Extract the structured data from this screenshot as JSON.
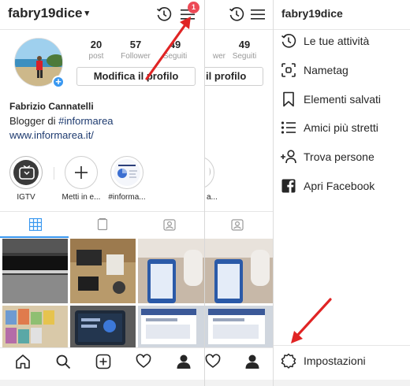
{
  "profile": {
    "username": "fabry19dice",
    "notification_count": "1",
    "stats": [
      {
        "value": "20",
        "label": "post"
      },
      {
        "value": "57",
        "label": "Follower"
      },
      {
        "value": "49",
        "label": "Seguiti"
      }
    ],
    "edit_button_label": "Modifica il profilo",
    "full_name": "Fabrizio Cannatelli",
    "bio_prefix": "Blogger di ",
    "bio_tag": "#informarea",
    "website": "www.informarea.it/",
    "highlights": [
      {
        "label": "IGTV"
      },
      {
        "label": "Metti in e..."
      },
      {
        "label": "#informa..."
      }
    ]
  },
  "pane2": {
    "stats": [
      {
        "value": "49",
        "label": "wer"
      },
      {
        "value": "49",
        "label": "Seguiti"
      }
    ],
    "edit_button_fragment": "il profilo",
    "highlight_fragment": "a..."
  },
  "menu": {
    "username": "fabry19dice",
    "items": [
      {
        "label": "Le tue attività",
        "icon": "activity-history-icon"
      },
      {
        "label": "Nametag",
        "icon": "nametag-icon"
      },
      {
        "label": "Elementi salvati",
        "icon": "bookmark-icon"
      },
      {
        "label": "Amici più stretti",
        "icon": "close-friends-list-icon"
      },
      {
        "label": "Trova persone",
        "icon": "add-person-icon"
      },
      {
        "label": "Apri Facebook",
        "icon": "facebook-icon"
      }
    ],
    "settings_label": "Impostazioni"
  },
  "colors": {
    "link": "#1d3a6f",
    "badge": "#ed4956",
    "arrow": "#e02424",
    "accent": "#3897f0"
  }
}
